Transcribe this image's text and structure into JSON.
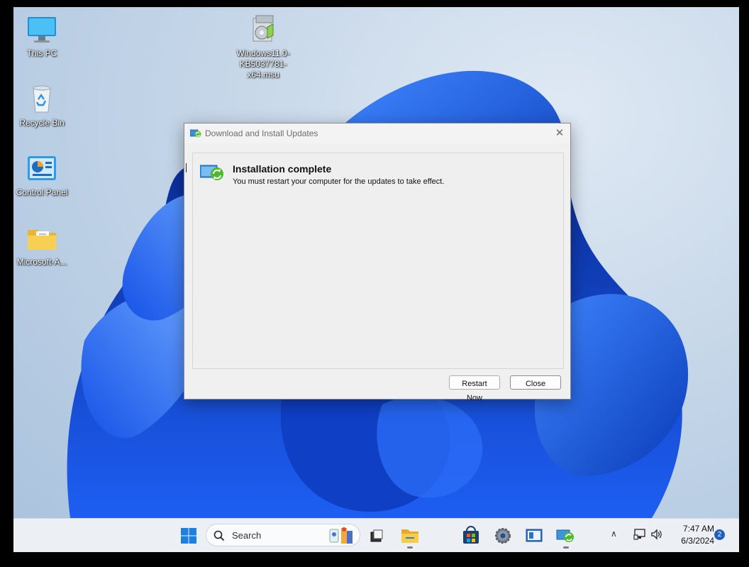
{
  "desktop": {
    "icons": [
      {
        "label": "This PC",
        "icon": "computer-icon"
      },
      {
        "label": "Windows11.0-KB5037781-x64.msu",
        "icon": "installer-package-icon"
      },
      {
        "label": "Recycle Bin",
        "icon": "recycle-bin-icon"
      },
      {
        "label": "Control Panel",
        "icon": "control-panel-icon"
      },
      {
        "label": "Microsoft-A...",
        "icon": "folder-icon"
      }
    ]
  },
  "dialog": {
    "title": "Download and Install Updates",
    "close_glyph": "✕",
    "heading": "Installation complete",
    "message": "You must restart your computer for the updates to take effect.",
    "buttons": {
      "restart": "Restart Now",
      "close": "Close"
    }
  },
  "taskbar": {
    "search_placeholder": "Search",
    "pinned": [
      "start-icon",
      "task-view-icon",
      "file-explorer-icon",
      "microsoft-store-icon",
      "settings-icon",
      "remote-desktop-icon",
      "windows-update-installer-icon"
    ],
    "clock": {
      "time": "7:47 AM",
      "date": "6/3/2024"
    },
    "notification_count": "2"
  },
  "colors": {
    "accent": "#1f5fc2",
    "wallpaper_blue": "#1c5df0",
    "taskbar_bg": "#ecf0f5"
  }
}
